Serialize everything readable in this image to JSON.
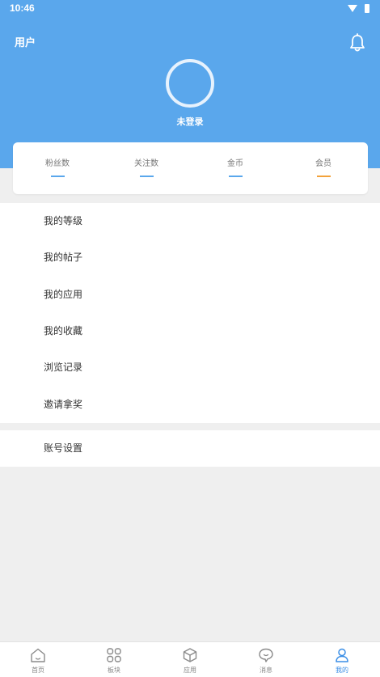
{
  "status_bar": {
    "time": "10:46"
  },
  "header": {
    "title": "用户",
    "login_status": "未登录"
  },
  "stats": [
    {
      "label": "粉丝数",
      "value": "--"
    },
    {
      "label": "关注数",
      "value": "--"
    },
    {
      "label": "金币",
      "value": "--"
    },
    {
      "label": "会员",
      "value": "--"
    }
  ],
  "menu": [
    {
      "label": "我的等级"
    },
    {
      "label": "我的帖子"
    },
    {
      "label": "我的应用"
    },
    {
      "label": "我的收藏"
    },
    {
      "label": "浏览记录"
    },
    {
      "label": "邀请拿奖"
    }
  ],
  "settings": {
    "label": "账号设置"
  },
  "tabs": [
    {
      "label": "首页",
      "icon": "home-icon"
    },
    {
      "label": "板块",
      "icon": "grid-icon"
    },
    {
      "label": "应用",
      "icon": "cube-icon"
    },
    {
      "label": "消息",
      "icon": "chat-icon"
    },
    {
      "label": "我的",
      "icon": "user-icon",
      "active": true
    }
  ],
  "colors": {
    "primary": "#5aa7ec",
    "accent_orange": "#f3a23b",
    "active_tab": "#3a8ee6"
  }
}
